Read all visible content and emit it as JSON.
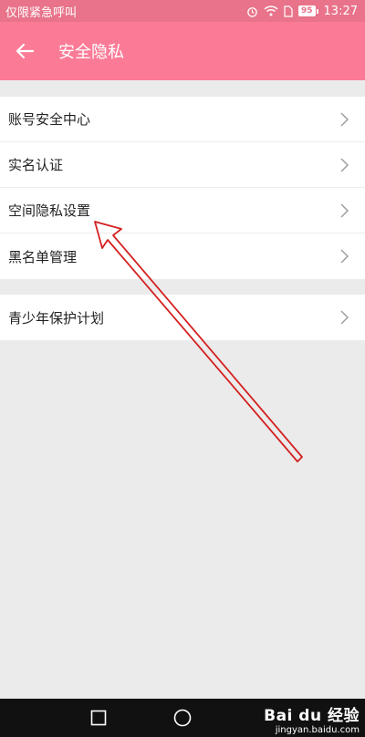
{
  "status_bar": {
    "carrier": "仅限紧急呼叫",
    "battery": "95",
    "time": "13:27"
  },
  "app_bar": {
    "title": "安全隐私"
  },
  "settings": {
    "group1": [
      {
        "label": "账号安全中心"
      },
      {
        "label": "实名认证"
      },
      {
        "label": "空间隐私设置"
      },
      {
        "label": "黑名单管理"
      }
    ],
    "group2": [
      {
        "label": "青少年保护计划"
      }
    ]
  },
  "watermark": {
    "main": "Bai du 经验",
    "sub": "jingyan.baidu.com"
  },
  "colors": {
    "status_bar": "#e8738a",
    "app_bar": "#fb7b96",
    "annotation_arrow": "#d42020"
  }
}
